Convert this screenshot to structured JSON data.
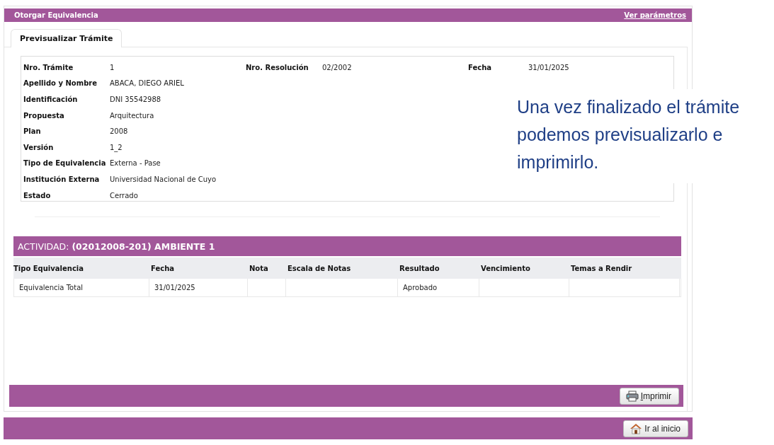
{
  "header": {
    "title": "Otorgar Equivalencia",
    "link": "Ver parámetros"
  },
  "tabs": [
    {
      "label": "Previsualizar Trámite",
      "selected": true
    }
  ],
  "details": {
    "rows": [
      [
        {
          "label": "Nro. Trámite",
          "value": "1"
        },
        {
          "label": "Nro. Resolución",
          "value": "02/2002"
        },
        {
          "label": "Fecha",
          "value": "31/01/2025"
        }
      ],
      [
        {
          "label": "Apellido y Nombre",
          "value": "ABACA, DIEGO ARIEL"
        }
      ],
      [
        {
          "label": "Identificación",
          "value": "DNI 35542988"
        }
      ],
      [
        {
          "label": "Propuesta",
          "value": "Arquitectura"
        }
      ],
      [
        {
          "label": "Plan",
          "value": "2008"
        }
      ],
      [
        {
          "label": "Versión",
          "value": "1_2"
        }
      ],
      [
        {
          "label": "Tipo de Equivalencia",
          "value": "Externa - Pase"
        }
      ],
      [
        {
          "label": "Institución Externa",
          "value": "Universidad Nacional de Cuyo"
        }
      ],
      [
        {
          "label": "Estado",
          "value": "Cerrado"
        }
      ]
    ]
  },
  "activity": {
    "title": "ACTIVIDAD: **(02012008-201) AMBIENTE 1**",
    "table": {
      "columns": [
        "Tipo Equivalencia",
        "Fecha",
        "Nota",
        "Escala de Notas",
        "Resultado",
        "Vencimiento",
        "Temas a Rendir"
      ],
      "rows": [
        {
          "cells": [
            "Equivalencia Total",
            "31/01/2025",
            null,
            null,
            "Aprobado",
            null,
            null
          ]
        }
      ]
    }
  },
  "actions": [
    {
      "label": "Imprimir"
    }
  ],
  "footer": {
    "button": {
      "label": "Ir al inicio"
    }
  },
  "callout": "Una vez finalizado el trámite podemos previsualizarlo e imprimirlo."
}
